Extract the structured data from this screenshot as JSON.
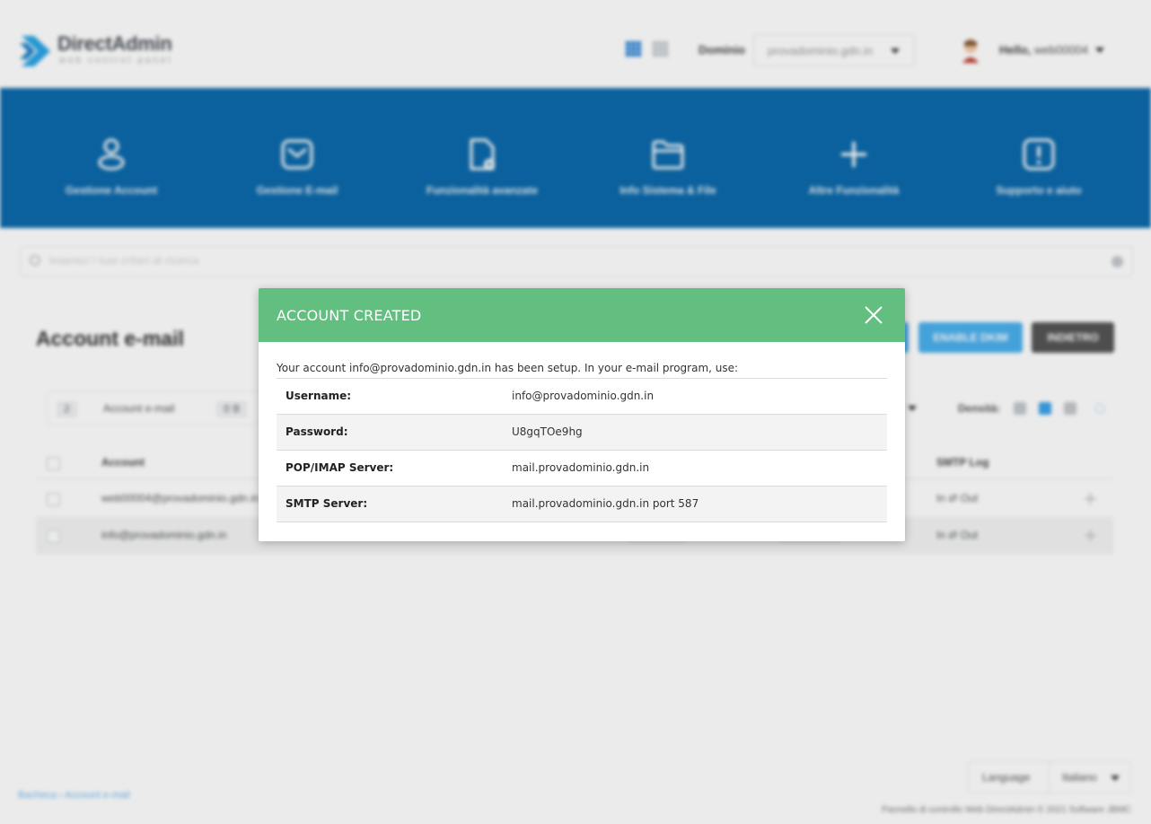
{
  "app": {
    "logo_text": "DirectAdmin",
    "logo_subtext": "web control panel"
  },
  "header": {
    "domain_label": "Dominio",
    "domain_value": "provadominio.gdn.in",
    "greeting": "Hello,",
    "username": "web00004"
  },
  "nav": [
    {
      "label": "Gestione Account",
      "icon": "user-icon"
    },
    {
      "label": "Gestione E-mail",
      "icon": "envelope-icon"
    },
    {
      "label": "Funzionalità avanzate",
      "icon": "advanced-document-icon"
    },
    {
      "label": "Info Sistema & File",
      "icon": "folder-icon"
    },
    {
      "label": "Altre Funzionalità",
      "icon": "plus-icon"
    },
    {
      "label": "Supporto e aiuto",
      "icon": "support-icon"
    }
  ],
  "search": {
    "placeholder": "Inserisci i tuoi criteri di ricerca"
  },
  "page": {
    "title": "Account e-mail",
    "buttons": {
      "enable_dkim": "ENABLE DKIM",
      "back": "INDIETRO"
    },
    "filter": {
      "count": "2",
      "label": "Account e-mail",
      "size": "0 B"
    },
    "density_label": "Densità:"
  },
  "table": {
    "headers": {
      "account": "Account",
      "smtp_log": "SMTP Log"
    },
    "rows": [
      {
        "account": "web00004@provadominio.gdn.in",
        "smtp_log": "In ⇄ Out"
      },
      {
        "account": "info@provadominio.gdn.in",
        "smtp_log": "In ⇄ Out"
      }
    ]
  },
  "breadcrumb": {
    "home": "Bacheca",
    "sep": " › ",
    "current": "Account e-mail"
  },
  "language": {
    "label": "Language",
    "value": "Italiano"
  },
  "footer": {
    "text": "Pannello di controllo Web DirectAdmin © 2021 Software JBMC"
  },
  "modal": {
    "title": "ACCOUNT CREATED",
    "intro": "Your account info@provadominio.gdn.in has been setup. In your e-mail program, use:",
    "rows": [
      {
        "key": "Username:",
        "value": "info@provadominio.gdn.in"
      },
      {
        "key": "Password:",
        "value": "U8gqTOe9hg"
      },
      {
        "key": "POP/IMAP Server:",
        "value": "mail.provadominio.gdn.in"
      },
      {
        "key": "SMTP Server:",
        "value": "mail.provadominio.gdn.in port 587"
      }
    ]
  },
  "colors": {
    "brand_blue": "#0d6aab",
    "modal_header_green": "#63bf80",
    "button_blue": "#4ab0ee",
    "button_dark": "#555555"
  }
}
